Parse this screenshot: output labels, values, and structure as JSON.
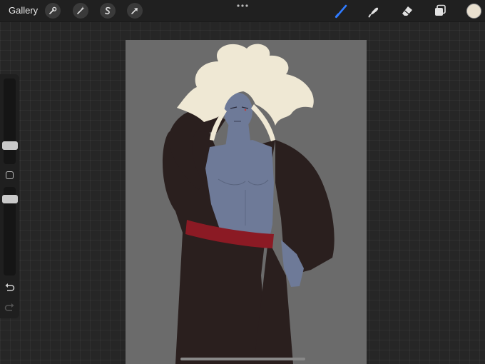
{
  "toolbar": {
    "gallery_label": "Gallery",
    "actions_icon": "wrench-icon",
    "adjustments_icon": "magic-wand-icon",
    "selection_icon": "selection-s-icon",
    "transform_icon": "arrow-cursor-icon",
    "more_icon": "ellipsis-icon",
    "brush_icon": "brush-icon",
    "smudge_icon": "smudge-icon",
    "eraser_icon": "eraser-icon",
    "layers_icon": "layers-icon",
    "active_tool": "brush"
  },
  "colors": {
    "active_color": "#e9e0cf",
    "brush_accent": "#2f7bff",
    "canvas_background": "#6b6b6b",
    "hair": "#efe8d4",
    "skin": "#6e7a98",
    "robe": "#2a1f1e",
    "sash": "#8b1a24"
  },
  "sidebar": {
    "brush_size_level": 0.3,
    "opacity_level": 0.65,
    "modify_icon": "square-icon",
    "undo_icon": "undo-icon",
    "redo_icon": "redo-icon"
  }
}
